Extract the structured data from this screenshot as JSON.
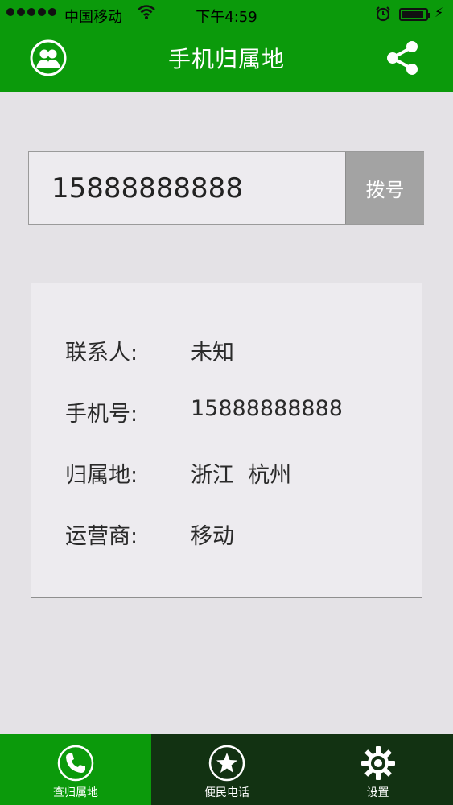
{
  "status_bar": {
    "carrier": "中国移动",
    "time": "下午4:59"
  },
  "header": {
    "title": "手机归属地",
    "left_icon": "contacts-icon",
    "right_icon": "share-icon"
  },
  "search": {
    "phone_value": "15888888888",
    "dial_label": "拨号"
  },
  "result": {
    "rows": [
      {
        "label": "联系人:",
        "value": "未知"
      },
      {
        "label": "手机号:",
        "value": "15888888888"
      },
      {
        "label": "归属地:",
        "value": "浙江  杭州"
      },
      {
        "label": "运营商:",
        "value": "移动"
      }
    ]
  },
  "tabs": [
    {
      "label": "查归属地",
      "icon": "phone-icon",
      "active": true
    },
    {
      "label": "便民电话",
      "icon": "star-icon",
      "active": false
    },
    {
      "label": "设置",
      "icon": "gear-icon",
      "active": false
    }
  ],
  "colors": {
    "brand_green": "#0b9a0b",
    "tabbar_dark": "#123212",
    "background": "#e4e2e6",
    "dial_gray": "#a3a3a3"
  }
}
